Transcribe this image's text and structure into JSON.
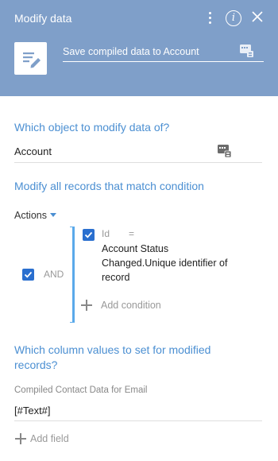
{
  "header": {
    "title": "Modify data",
    "process_element_name": "Save compiled data to Account",
    "menu_icon": "more-vertical-icon",
    "info_icon": "info-icon",
    "close_icon": "close-icon"
  },
  "object_section": {
    "title": "Which object to modify data of?",
    "value": "Account"
  },
  "condition_section": {
    "title": "Modify all records that match condition",
    "actions_label": "Actions",
    "group_operator": "AND",
    "condition": {
      "column": "Id",
      "operator": "=",
      "value": "Account Status Changed.Unique identifier of record"
    },
    "add_condition_label": "Add condition"
  },
  "values_section": {
    "title": "Which column values to set for modified records?",
    "field_label": "Compiled Contact Data for Email",
    "field_value": "[#Text#]",
    "add_field_label": "Add field"
  },
  "colors": {
    "header_bg": "#7f9fc9",
    "accent": "#4b8fd2",
    "checkbox": "#2a6fcf"
  }
}
